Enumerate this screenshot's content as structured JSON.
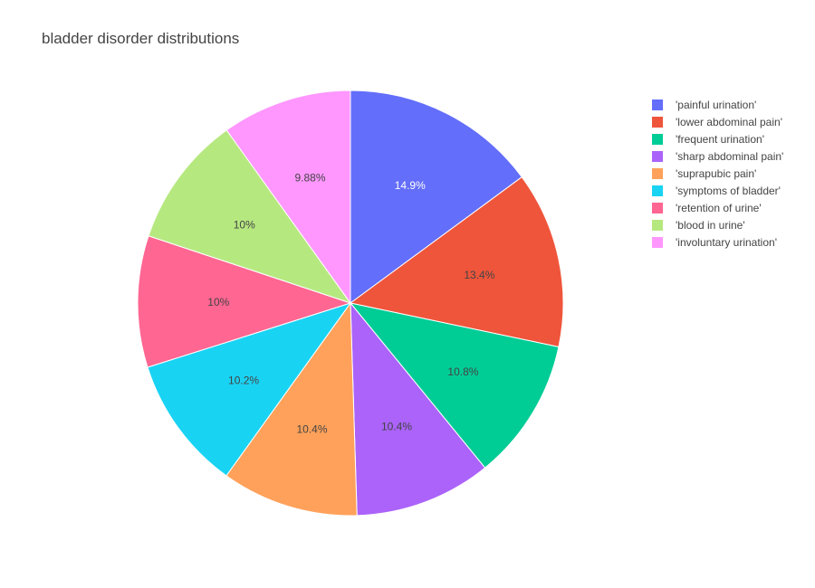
{
  "chart_data": {
    "type": "pie",
    "title": "bladder disorder distributions",
    "labels": [
      "'painful urination'",
      "'lower abdominal pain'",
      "'frequent urination'",
      "'sharp abdominal pain'",
      "'suprapubic pain'",
      "'symptoms of bladder'",
      "'retention of urine'",
      "'blood in urine'",
      "'involuntary urination'"
    ],
    "values": [
      14.9,
      13.4,
      10.8,
      10.4,
      10.4,
      10.2,
      10.0,
      10.0,
      9.88
    ],
    "value_labels": [
      "14.9%",
      "13.4%",
      "10.8%",
      "10.4%",
      "10.4%",
      "10.2%",
      "10%",
      "10%",
      "9.88%"
    ],
    "colors": [
      "#636efa",
      "#EF553B",
      "#00cc96",
      "#ab63fa",
      "#FFA15A",
      "#19d3f3",
      "#FF6692",
      "#B6E880",
      "#FF97FF"
    ],
    "label_colors": [
      "#ffffff",
      "#444444",
      "#444444",
      "#444444",
      "#444444",
      "#444444",
      "#444444",
      "#444444",
      "#444444"
    ],
    "legend": "top-right"
  }
}
